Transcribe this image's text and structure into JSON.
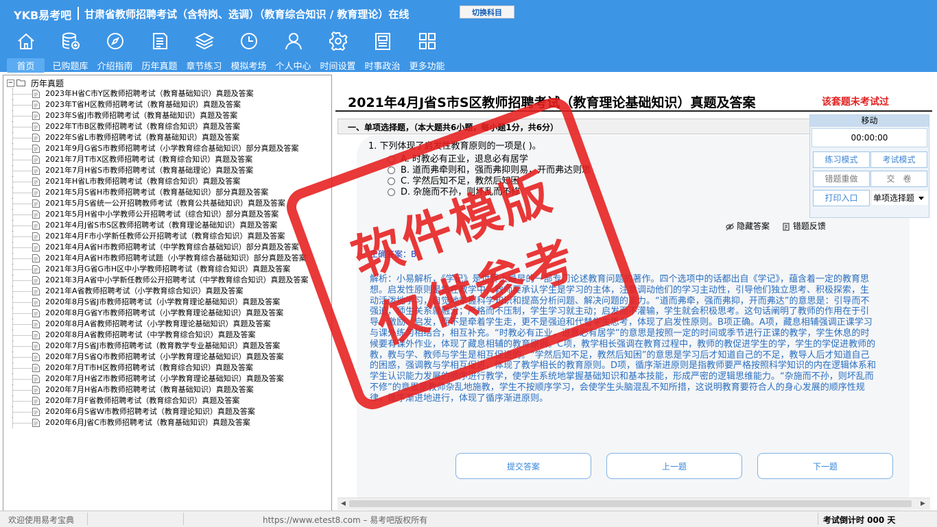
{
  "app": {
    "logo": "YKB易考吧",
    "title": "甘肃省教师招聘考试（含特岗、选调）（教育综合知识 / 教育理论）在线",
    "switch_subject": "切换科目"
  },
  "nav": [
    {
      "label": "首页",
      "icon": "home-icon",
      "active": true
    },
    {
      "label": "已购题库",
      "icon": "database-icon"
    },
    {
      "label": "介绍指南",
      "icon": "compass-icon"
    },
    {
      "label": "历年真题",
      "icon": "document-list-icon"
    },
    {
      "label": "章节练习",
      "icon": "layers-icon"
    },
    {
      "label": "模拟考场",
      "icon": "clock-icon"
    },
    {
      "label": "个人中心",
      "icon": "user-icon"
    },
    {
      "label": "时间设置",
      "icon": "gear-icon"
    },
    {
      "label": "时事政治",
      "icon": "newspaper-icon"
    },
    {
      "label": "更多功能",
      "icon": "grid-icon"
    }
  ],
  "tree": {
    "root_label": "历年真题",
    "toggle": "−",
    "items": [
      "2023年H省C市Y区教师招聘考试（教育基础知识）真题及答案",
      "2023年T省H区教师招聘考试（教育基础知识）真题及答案",
      "2023年S省J市教师招聘考试（教育基础知识）真题及答案",
      "2022年T市B区教师招聘考试（教育综合知识）真题及答案",
      "2022年S省L市教师招聘考试（教育基础知识）真题及答案",
      "2021年9月G省S市教师招聘考试（小学教育综合基础知识）部分真题及答案",
      "2021年7月T市X区教师招聘考试（教育综合知识）真题及答案",
      "2021年7月H省S市教师招聘考试（教育基础理论）真题及答案",
      "2021年H省L市教师招聘考试（教育综合知识）真题及答案",
      "2021年5月S省H市教师招聘考试（教育基础知识）部分真题及答案",
      "2021年5月S省统一公开招聘教师考试（教育公共基础知识）真题及答案",
      "2021年5月H省中小学教师公开招聘考试（综合知识）部分真题及答案",
      "2021年4月J省S市S区教师招聘考试（教育理论基础知识）真题及答案",
      "2021年4月F市小学新任教师公开招聘考试（教育综合知识）真题及答案",
      "2021年4月A省H市教师招聘考试（中学教育综合基础知识）部分真题及答案",
      "2021年4月A省H市教师招聘考试题（小学教育综合基础知识）部分真题及答案",
      "2021年3月G省G市H区中小学教师招聘考试（教育综合知识）真题及答案",
      "2021年3月A省中小学新任教师公开招聘考试（中学教育综合知识）真题及答案",
      "2021年A省教师招聘考试（小学教育综合知识）真题及答案",
      "2020年8月S省J市教师招聘考试（小学教育理论基础知识）真题及答案",
      "2020年8月G省Y市教师招聘考试（小学教育理论基础知识）真题及答案",
      "2020年8月A省教师招聘考试（小学教育理论基础知识）真题及答案",
      "2020年8月A省教师招聘考试（中学教育综合知识）真题及答案",
      "2020年7月S省J市教师招聘考试（教育教学专业基础知识）真题及答案",
      "2020年7月S省Q市教师招聘考试（小学教育理论基础知识）真题及答案",
      "2020年7月T市H区教师招聘考试（教育综合知识）真题及答案",
      "2020年7月H省Z市教师招聘考试（小学教育理论基础知识）真题及答案",
      "2020年7月H省A市教师招聘考试（教育基础知识）真题及答案",
      "2020年7月F省教师招聘考试（教育综合知识）真题及答案",
      "2020年6月S省W市教师招聘考试（教育理论知识）真题及答案",
      "2020年6月J省C市教师招聘考试（教育基础知识）真题及答案"
    ]
  },
  "exam": {
    "title": "2021年4月J省S市S区教师招聘考试（教育理论基础知识）真题及答案",
    "status": "该套题未考试过",
    "section": "一、单项选择题，（本大题共6小题，每小题1分，共6分）",
    "question": "1. 下列体现了启发性教育原则的一项是(  )。",
    "options": [
      "A. 时教必有正业，退息必有居学",
      "B. 道而弗牵则和，强而弗抑则易，开而弗达则思",
      "C. 学然后知不足，教然后知困",
      "D. 杂施而不孙，则坏乱而不修"
    ],
    "tools": {
      "hide_answer": "隐藏答案",
      "report_error": "错题反馈"
    },
    "answer_label": "正确答案：B",
    "analysis": "解析：小易解析，《学记》是世界上最早的一部专门论述教育问题的著作。四个选项中的话都出自《学记》，蕴含着一定的教育思想。启发性原则是指在教学中，教师要承认学生是学习的主体，注意调动他们的学习主动性，引导他们独立思考、积极探索，生动活泼地学习，自觉地掌握科学知识和提高分析问题、解决问题的能力。“道而弗牵，强而弗抑，开而弗达”的意思是：引导而不强迫，师生关系就融洽；严格而不压制，学生学习就主动；启发而不灌输，学生就会积极思考。这句话阐明了教师的作用在于引导、激励、启发，而不是牵着学生走，更不是强迫和代替学生思考，体现了启发性原则。B项正确。A项，藏息相辅强调正课学习与课外练习相结合，相互补充。“时教必有正业，退息必有居学”的意思是按照一定的时间或季节进行正课的教学，学生休息的时候要有课外作业，体现了藏息相辅的教育原则。C项，教学相长强调在教育过程中，教师的教促进学生的学，学生的学促进教师的教，教与学、教师与学生是相互促进的。“学然后知不足，教然后知困”的意思是学习后才知道自己的不足，教导人后才知道自己的困惑，强调教与学相互促进，体现了教学相长的教育原则。D项，循序渐进原则是指教师要严格按照科学知识的内在逻辑体系和学生认识能力发展的顺序进行教学，使学生系统地掌握基础知识和基本技能，形成严密的逻辑思维能力。“杂施而不孙，则坏乱而不修”的意思是教师杂乱地施教，学生不按顺序学习，会使学生头脑混乱不知所措，这说明教育要符合人的身心发展的顺序性规律，循序渐进地进行，体现了循序渐进原则。",
    "buttons": {
      "submit": "提交答案",
      "prev": "上一题",
      "next": "下一题"
    }
  },
  "control": {
    "header": "移动",
    "timer": "00:00:00",
    "practice_mode": "练习模式",
    "exam_mode": "考试模式",
    "redo_wrong": "错题重做",
    "submit_paper": "交　卷",
    "print": "打印入口",
    "question_type": "单项选择题"
  },
  "watermark": {
    "line1": "软件模版",
    "line2": "仅供参考"
  },
  "status": {
    "welcome": "欢迎使用易考宝典",
    "copyright": "https://www.etest8.com – 易考吧版权所有",
    "countdown": "考试倒计时 000 天"
  },
  "colors": {
    "header_blue": "#3d95e6",
    "stamp_red": "#e61e1e",
    "status_red": "#e02020",
    "analysis_blue": "#2a6fc0"
  }
}
